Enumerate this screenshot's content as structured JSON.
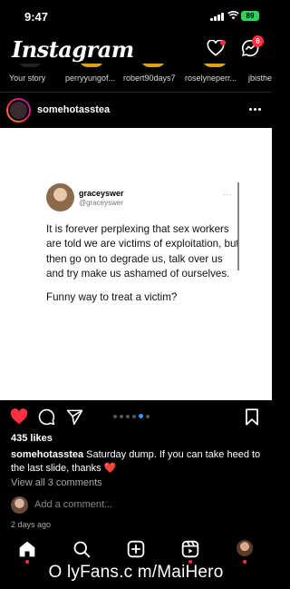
{
  "status_bar": {
    "time": "9:47",
    "battery": "89",
    "icons": [
      "signal-icon",
      "wifi-icon",
      "battery-icon"
    ]
  },
  "header": {
    "logo": "Instagram",
    "activity_icon": "heart-icon",
    "messages_icon": "messenger-icon",
    "messages_badge": "6"
  },
  "stories": [
    {
      "label": "Your story"
    },
    {
      "label": "perryyungof..."
    },
    {
      "label": "robert90days7"
    },
    {
      "label": "roselyneperr..."
    },
    {
      "label": "jbisthe"
    }
  ],
  "post": {
    "username": "somehotasstea",
    "tweet": {
      "name": "graceyswer",
      "handle": "@graceyswer",
      "more": "...",
      "paragraphs": [
        "It is forever perplexing that sex workers are told we are victims of exploitation, but then go on to degrade us, talk over us and try make us ashamed of ourselves.",
        "Funny way to treat a victim?"
      ]
    },
    "likes": "435 likes",
    "caption_user": "somehotasstea",
    "caption_text": " Saturday dump. If you can take heed to the last slide, thanks ",
    "caption_emoji": "❤️",
    "view_comments": "View all 3 comments",
    "add_comment_placeholder": "Add a comment...",
    "timestamp": "2 days ago",
    "carousel": {
      "count": 6,
      "active": 4
    }
  },
  "nav": {
    "items": [
      "home-icon",
      "search-icon",
      "create-icon",
      "reels-icon",
      "profile-avatar"
    ]
  },
  "watermark": "O lyFans.c m/MaiHero",
  "colors": {
    "like_red": "#ff3040",
    "badge_red": "#ff3040",
    "battery_green": "#30d158",
    "carousel_active": "#3897f0"
  }
}
